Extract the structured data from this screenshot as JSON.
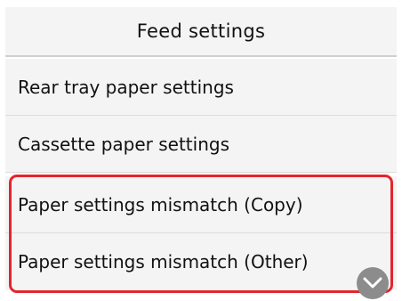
{
  "header": {
    "title": "Feed settings"
  },
  "menu": {
    "items": [
      {
        "label": "Rear tray paper settings"
      },
      {
        "label": "Cassette paper settings"
      },
      {
        "label": "Paper settings mismatch (Copy)"
      },
      {
        "label": "Paper settings mismatch (Other)"
      }
    ]
  },
  "scroll_button": {
    "icon": "chevron-down-icon"
  },
  "colors": {
    "highlight": "#e3262e",
    "background": "#f4f4f4",
    "scroll_button": "#8c8c8c"
  }
}
